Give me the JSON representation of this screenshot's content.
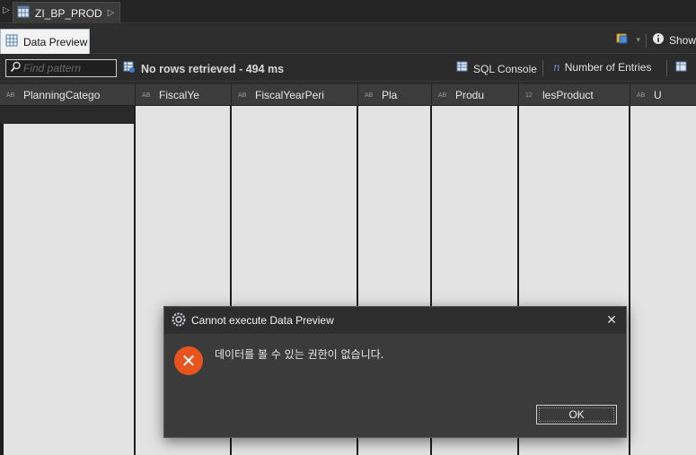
{
  "editor": {
    "tab_label": "ZI_BP_PROD"
  },
  "view": {
    "tab_label": "Data Preview",
    "show_label": "Show"
  },
  "toolbar": {
    "filter_placeholder": "Find pattern",
    "status_text": "No rows retrieved - 494 ms",
    "sql_console_label": "SQL Console",
    "number_entries_label": "Number of Entries"
  },
  "grid": {
    "columns": [
      {
        "type": "AB",
        "name": "PlanningCatego"
      },
      {
        "type": "AB",
        "name": "FiscalYe"
      },
      {
        "type": "AB",
        "name": "FiscalYearPeri"
      },
      {
        "type": "AB",
        "name": "Pla"
      },
      {
        "type": "AB",
        "name": "Produ"
      },
      {
        "type": "12",
        "name": "lesProduct"
      },
      {
        "type": "AB",
        "name": "U"
      }
    ]
  },
  "dialog": {
    "title": "Cannot execute Data Preview",
    "message": "데이터를 볼 수 있는 권한이 없습니다.",
    "ok_label": "OK"
  },
  "colors": {
    "error_icon": "#e8541e",
    "background": "#2b2b2b",
    "grid_body": "#e3e3e3"
  }
}
